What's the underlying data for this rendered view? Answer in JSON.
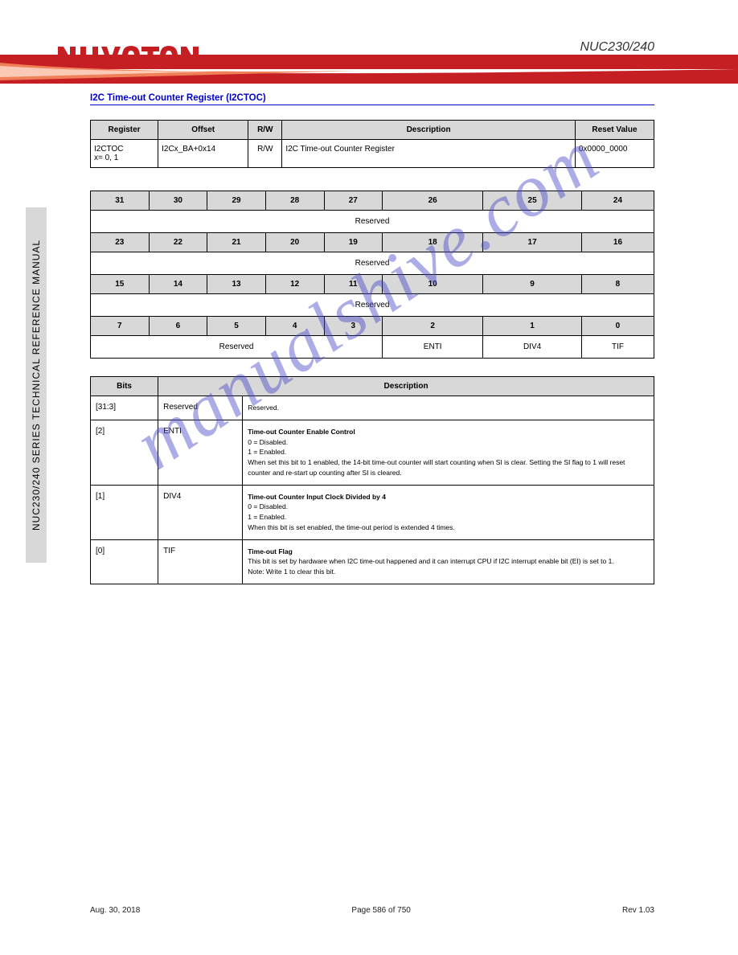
{
  "header": {
    "product": "NUC230/240"
  },
  "section_title": "I2C Time-out Counter Register (I2CTOC)",
  "table1": {
    "headers": [
      "Register",
      "Offset",
      "R/W",
      "Description",
      "Reset Value"
    ],
    "row": {
      "register": "I2CTOC\nx= 0, 1",
      "offset": "I2Cx_BA+0x14",
      "rw": "R/W",
      "description": "I2C Time-out Counter Register",
      "reset": "0x0000_0000"
    }
  },
  "table2": {
    "rows": [
      {
        "hdr": [
          "31",
          "30",
          "29",
          "28",
          "27",
          "26",
          "25",
          "24"
        ],
        "val": "Reserved"
      },
      {
        "hdr": [
          "23",
          "22",
          "21",
          "20",
          "19",
          "18",
          "17",
          "16"
        ],
        "val": "Reserved"
      },
      {
        "hdr": [
          "15",
          "14",
          "13",
          "12",
          "11",
          "10",
          "9",
          "8"
        ],
        "val": "Reserved"
      },
      {
        "hdr": [
          "7",
          "6",
          "5",
          "4",
          "3",
          "2",
          "1",
          "0"
        ],
        "split": [
          "Reserved",
          "ENTI",
          "DIV4",
          "TIF"
        ]
      }
    ]
  },
  "table3": {
    "headers": [
      "Bits",
      "Description"
    ],
    "rows": [
      {
        "bits": "[31:3]",
        "name": "Reserved",
        "desc": "Reserved."
      },
      {
        "bits": "[2]",
        "name": "ENTI",
        "desc_title": "Time-out Counter Enable Control",
        "desc_lines": [
          "0 = Disabled.",
          "1 = Enabled.",
          "When set this bit to 1 enabled, the 14-bit time-out counter will start counting when SI is clear. Setting the SI flag to 1 will reset counter and re-start up counting after SI is cleared."
        ]
      },
      {
        "bits": "[1]",
        "name": "DIV4",
        "desc_title": "Time-out Counter Input Clock Divided by 4",
        "desc_lines": [
          "0 = Disabled.",
          "1 = Enabled.",
          "When this bit is set enabled, the time-out period is extended 4 times."
        ]
      },
      {
        "bits": "[0]",
        "name": "TIF",
        "desc_title": "Time-out Flag",
        "desc_lines": [
          "This bit is set by hardware when I2C time-out happened and it can interrupt CPU if I2C interrupt enable bit (EI) is set to 1.",
          "Note: Write 1 to clear this bit."
        ]
      }
    ]
  },
  "sidebar": "NUC230/240 SERIES TECHNICAL REFERENCE MANUAL",
  "footer": {
    "left": "Aug. 30, 2018",
    "center": "Page 586 of 750",
    "right": "Rev 1.03"
  },
  "watermark": "manualshive.com"
}
